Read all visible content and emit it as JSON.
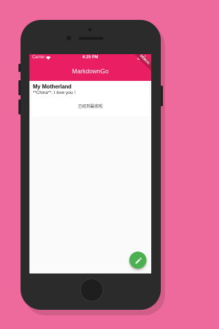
{
  "status_bar": {
    "carrier": "Carrier",
    "time": "6:25 PM"
  },
  "app_bar": {
    "title": "MarkdownGo",
    "debug_banner": "DEBUG"
  },
  "list": {
    "items": [
      {
        "title": "My Motherland",
        "body": "**China**, I love you !"
      }
    ],
    "end_text": "已经到最底啦"
  },
  "fab": {
    "icon": "pencil-icon",
    "color": "#4caf50"
  },
  "colors": {
    "background": "#ee6a9c",
    "accent": "#e91e63"
  }
}
